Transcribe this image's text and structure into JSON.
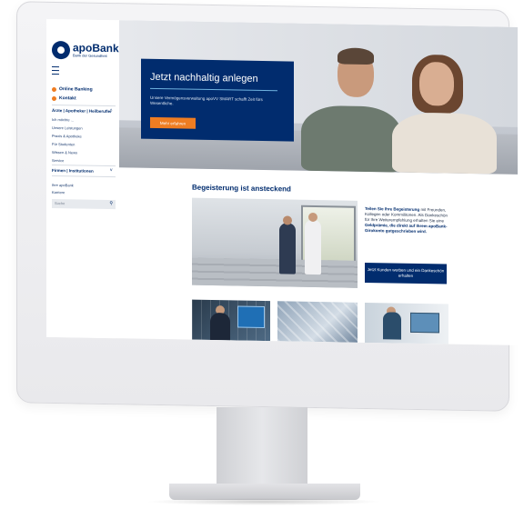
{
  "brand": {
    "name": "apoBank",
    "tagline": "Bank der Gesundheit"
  },
  "sidebar": {
    "quick_links": [
      "Online Banking",
      "Kontakt"
    ],
    "section1": {
      "heading": "Ärzte | Apotheker | Heilberufler",
      "links": [
        "Ich möchte ...",
        "Unsere Leistungen",
        "Praxis & Apotheke",
        "Für Studenten",
        "Wissen & News",
        "Service"
      ]
    },
    "section2": {
      "heading": "Firmen | Institutionen"
    },
    "extra_links": [
      "Ihre apoBank",
      "Karriere"
    ],
    "search": {
      "placeholder": "Suche"
    }
  },
  "hero": {
    "title": "Jetzt nachhaltig anlegen",
    "text": "Unsere Vermögensverwaltung apoVV SMART schafft Zeit fürs Wesentliche.",
    "button": "Mehr erfahren"
  },
  "main": {
    "title": "Begeisterung ist ansteckend",
    "text_bold_1": "Teilen Sie Ihre Begeisterung",
    "text_1": " mit Freunden, Kollegen oder Kommilitonen. Als Dankeschön für Ihre Weiterempfehlung erhalten Sie eine ",
    "text_bold_2": "Geldprämie, die direkt auf Ihrem apoBank-Girokonto gutgeschrieben wird.",
    "cta": "Jetzt Kunden werben und ein Dankeschön erhalten"
  },
  "colors": {
    "primary": "#012c6e",
    "accent": "#ef7d22"
  }
}
